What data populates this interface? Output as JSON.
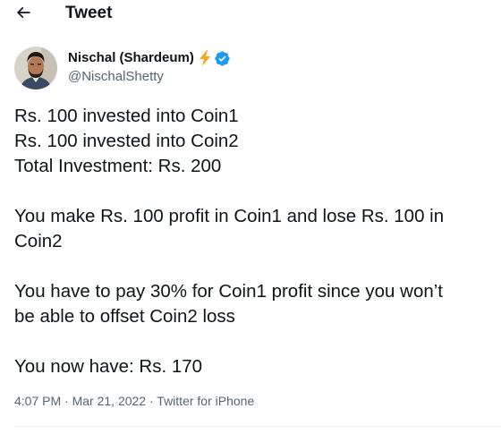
{
  "header": {
    "title": "Tweet",
    "back_icon": "arrow-left-icon"
  },
  "author": {
    "name": "Nischal (Shardeum)",
    "emoji_icon": "lightning-bolt-icon",
    "verified_icon": "verified-badge-icon",
    "handle": "@NischalShetty",
    "colors": {
      "verified": "#1d9bf0",
      "bolt": "#f5a623"
    }
  },
  "tweet": {
    "lines": [
      "Rs. 100 invested into Coin1",
      "Rs. 100 invested into Coin2",
      "Total Investment: Rs. 200",
      "",
      "You make Rs. 100 profit in Coin1 and lose Rs. 100 in",
      "Coin2",
      "",
      "You have to pay 30% for Coin1 profit since you won’t",
      "be able to offset Coin2 loss",
      "",
      "You now have: Rs. 170"
    ]
  },
  "meta": {
    "time": "4:07 PM",
    "separator": " · ",
    "date": "Mar 21, 2022",
    "source": "Twitter for iPhone"
  }
}
